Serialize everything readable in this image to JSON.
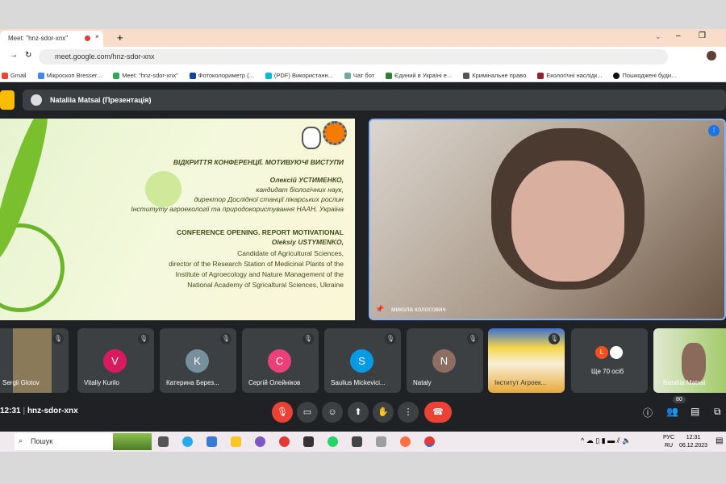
{
  "browser": {
    "tab_title": "Meet: \"hnz-sdor-xnx\"",
    "url": "meet.google.com/hnz-sdor-xnx",
    "bookmarks": [
      "Gmail",
      "Мікроскоп Bresser...",
      "Meet: \"hnz-sdor-xnx\"",
      "Фотоколориметр (...",
      "(PDF) Використанн...",
      "Чат бот",
      "Єдиний в Україні е...",
      "Кримінальне право",
      "Екологічні наслідк...",
      "Пошкоджені буди..."
    ]
  },
  "presentation": {
    "presenter": "Nataliia Matsai (Презентація)"
  },
  "slide": {
    "title_ua": "ВІДКРИТТЯ КОНФЕРЕНЦІЇ. МОТИВУЮЧІ ВИСТУПИ",
    "speaker_ua": "Олексій УСТИМЕНКО,",
    "lines_ua": [
      "кандидат біологічних наук,",
      "директор Дослідної станції лікарських рослин",
      "Інституту агроекології та природокористування НААН, Україна"
    ],
    "title_en": "CONFERENCE OPENING. REPORT MOTIVATIONAL",
    "speaker_en": "Oleksiy USTYMENKO,",
    "lines_en": [
      "Candidate of Agricultural Sciences,",
      "director of the Research Station of Medicinal Plants of the",
      "Institute of Agroecology and Nature Management of the",
      "National Academy of Sgricaltural Sciences, Ukraine"
    ],
    "logo_text": "100 років"
  },
  "main_video": {
    "name": "микола колосович"
  },
  "participants": [
    {
      "name": "Sergii Glotov",
      "initial": "",
      "color": ""
    },
    {
      "name": "Vitaliy Kurilo",
      "initial": "V",
      "color": "#d81b60"
    },
    {
      "name": "Катерина Берез...",
      "initial": "K",
      "color": "#78909c"
    },
    {
      "name": "Сергій Олейніков",
      "initial": "C",
      "color": "#ec407a"
    },
    {
      "name": "Saulius Mickevici...",
      "initial": "S",
      "color": "#039be5"
    },
    {
      "name": "Nataly",
      "initial": "N",
      "color": "#8d6e63"
    },
    {
      "name": "Інститут Агроек...",
      "initial": "",
      "color": ""
    },
    {
      "name": "Ще 70 осіб",
      "initial": "L",
      "color": "#f4511e"
    },
    {
      "name": "Nataliia Matsai",
      "initial": "",
      "color": ""
    }
  ],
  "footer": {
    "time": "12:31",
    "meeting_code": "hnz-sdor-xnx",
    "participant_count": "80"
  },
  "taskbar": {
    "search": "Пошук",
    "lang": "РУС",
    "lang2": "RU",
    "clock": "12:31",
    "date": "06.12.2023"
  }
}
